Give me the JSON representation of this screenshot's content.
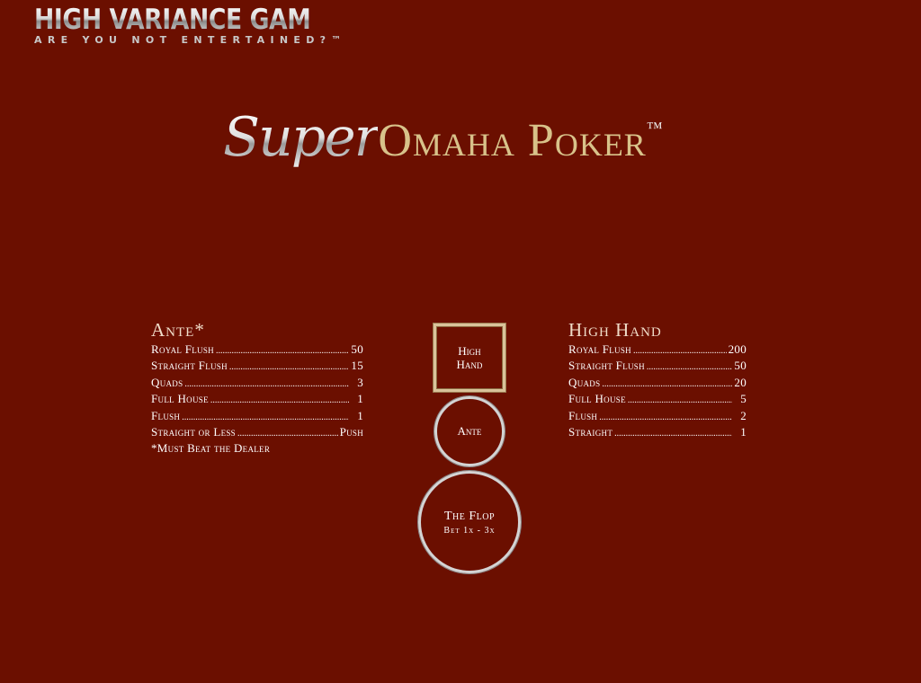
{
  "brand": {
    "name": "HIGH VARIANCE GAMES",
    "tagline": "ARE YOU NOT ENTERTAINED?™"
  },
  "game": {
    "title_script": "Super",
    "title_main": "Omaha Poker",
    "trademark": "™"
  },
  "ante_paytable": {
    "heading": "Ante*",
    "rows": [
      {
        "hand": "Royal Flush",
        "payout": "50"
      },
      {
        "hand": "Straight Flush",
        "payout": "15"
      },
      {
        "hand": "Quads",
        "payout": "3"
      },
      {
        "hand": "Full House",
        "payout": "1"
      },
      {
        "hand": "Flush",
        "payout": "1"
      },
      {
        "hand": "Straight or Less",
        "payout": "Push"
      }
    ],
    "footnote": "*Must Beat the Dealer"
  },
  "high_hand_paytable": {
    "heading": "High Hand",
    "rows": [
      {
        "hand": "Royal Flush",
        "payout": "200"
      },
      {
        "hand": "Straight Flush",
        "payout": "50"
      },
      {
        "hand": "Quads",
        "payout": "20"
      },
      {
        "hand": "Full House",
        "payout": "5"
      },
      {
        "hand": "Flush",
        "payout": "2"
      },
      {
        "hand": "Straight",
        "payout": "1"
      }
    ]
  },
  "bet_spots": {
    "high_hand": {
      "line1": "High",
      "line2": "Hand"
    },
    "ante": {
      "label": "Ante"
    },
    "flop": {
      "label": "The Flop",
      "sub": "Bet 1x - 3x"
    }
  },
  "colors": {
    "felt": "#6b0f00",
    "gold": "#d8c28a",
    "silver": "#d4d4d4"
  }
}
